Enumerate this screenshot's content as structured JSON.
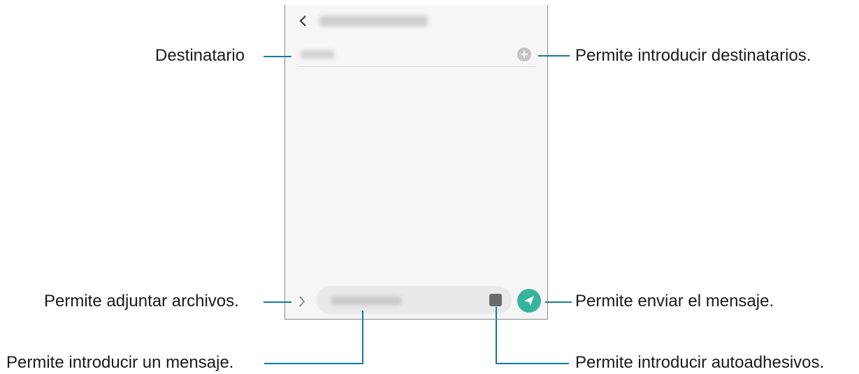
{
  "callouts": {
    "recipient": "Destinatario",
    "add_recipients": "Permite introducir destinatarios.",
    "attach_files": "Permite adjuntar archivos.",
    "send_message": "Permite enviar el mensaje.",
    "enter_message": "Permite introducir un mensaje.",
    "enter_stickers": "Permite introducir autoadhesivos."
  },
  "phone": {
    "icons": {
      "back": "back-arrow-icon",
      "add_recipient": "add-icon",
      "expand": "chevron-right-icon",
      "sticker": "sticker-icon",
      "send": "send-icon"
    },
    "colors": {
      "send_button": "#37b59c",
      "callout_line": "#1279a6"
    }
  }
}
